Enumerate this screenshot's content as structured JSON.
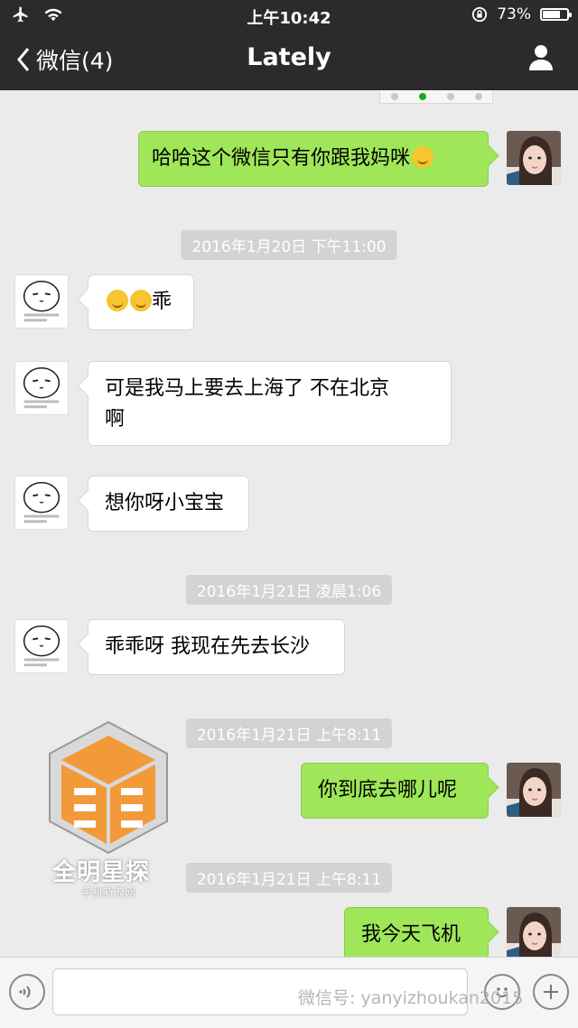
{
  "status_bar": {
    "time": "上午10:42",
    "battery": "73%",
    "battery_level": 0.73
  },
  "nav": {
    "back_label": "微信(4)",
    "title": "Lately"
  },
  "messages": [
    {
      "type": "text",
      "side": "out",
      "text": "哈哈这个微信只有你跟我妈咪",
      "emoji_after": 1
    },
    {
      "type": "time",
      "text": "2016年1月20日 下午11:00"
    },
    {
      "type": "text",
      "side": "in",
      "text": "乖",
      "emoji_before": 2
    },
    {
      "type": "text",
      "side": "in",
      "line1": "可是我马上要去上海了 不在北京",
      "line2": "啊"
    },
    {
      "type": "text",
      "side": "in",
      "text": "想你呀小宝宝"
    },
    {
      "type": "time",
      "text": "2016年1月21日 凌晨1:06"
    },
    {
      "type": "text",
      "side": "in",
      "text": "乖乖呀 我现在先去长沙"
    },
    {
      "type": "time",
      "text": "2016年1月21日 上午8:11"
    },
    {
      "type": "text",
      "side": "out",
      "text": "你到底去哪儿呢"
    },
    {
      "type": "time",
      "text": "2016年1月21日 上午8:11"
    },
    {
      "type": "text",
      "side": "out",
      "text": "我今天飞机"
    }
  ],
  "watermark": {
    "title": "全明星探",
    "subtitle": "手机新浪网"
  },
  "credit": "微信号: yanyizhoukan2015",
  "colors": {
    "nav_bg": "#2b2b2d",
    "chat_bg": "#ebebeb",
    "bubble_out": "#9fe658",
    "bubble_in": "#ffffff",
    "timestamp_bg": "#d3d3d3"
  },
  "icons": [
    "airplane-icon",
    "wifi-icon",
    "lock-rotation-icon",
    "battery-icon",
    "back-chevron-icon",
    "profile-icon",
    "voice-icon",
    "emoji-icon",
    "plus-icon"
  ]
}
